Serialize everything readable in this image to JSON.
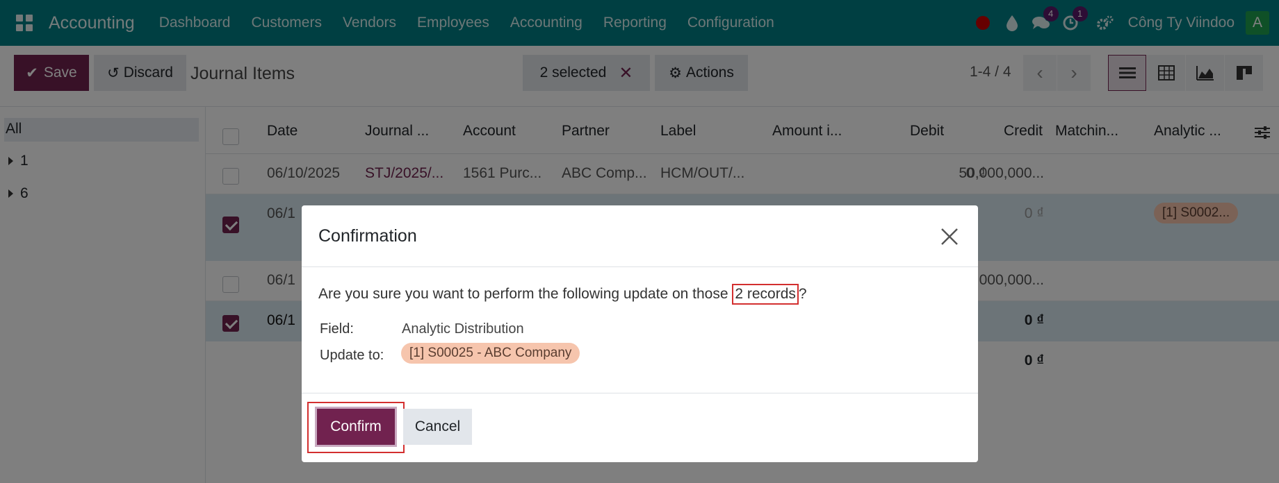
{
  "navbar": {
    "brand": "Accounting",
    "menu": [
      "Dashboard",
      "Customers",
      "Vendors",
      "Employees",
      "Accounting",
      "Reporting",
      "Configuration"
    ],
    "messages_badge": "4",
    "activities_badge": "1",
    "company": "Công Ty Viindoo",
    "avatar_letter": "A"
  },
  "control": {
    "save_label": "Save",
    "discard_label": "Discard",
    "title": "Journal Items",
    "selected_label": "2 selected",
    "actions_label": "Actions",
    "pager": "1-4 / 4"
  },
  "sidebar": {
    "all_label": "All",
    "items": [
      "1",
      "6"
    ]
  },
  "list": {
    "columns": [
      "Date",
      "Journal ...",
      "Account",
      "Partner",
      "Label",
      "Amount i...",
      "Debit",
      "Credit",
      "Matchin...",
      "Analytic ..."
    ],
    "rows": [
      {
        "date": "06/10/2025",
        "journal": "STJ/2025/...",
        "account": "1561 Purc...",
        "partner": "ABC Comp...",
        "label": "HCM/OUT/...",
        "debit": "0 ₫",
        "credit": "50,000,000...",
        "checked": false
      },
      {
        "date": "06/1",
        "credit": "0 ₫",
        "analytic": "[1] S0002...",
        "checked": true
      },
      {
        "date": "06/1",
        "credit": ",000,000...",
        "checked": false
      },
      {
        "date": "06/1",
        "credit": "0 ₫",
        "checked": true
      }
    ],
    "total_credit": "0 ₫"
  },
  "modal": {
    "title": "Confirmation",
    "question_before": "Are you sure you want to perform the following update on those ",
    "question_highlight": "2 records",
    "question_after": "?",
    "field_label": "Field:",
    "field_value": "Analytic Distribution",
    "update_label": "Update to:",
    "update_value": "[1] S00025 - ABC Company",
    "confirm_label": "Confirm",
    "cancel_label": "Cancel"
  },
  "colors": {
    "navbar": "#017e84",
    "primary": "#71224f",
    "highlight": "#d32f2f"
  }
}
